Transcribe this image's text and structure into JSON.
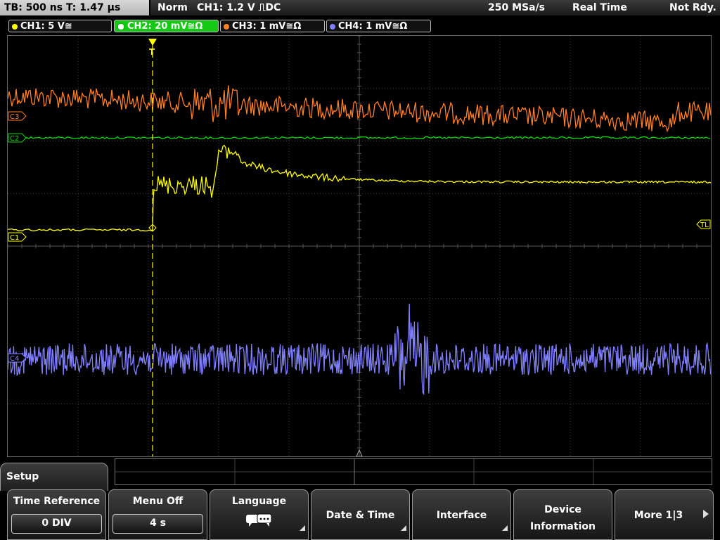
{
  "header": {
    "timebase": "TB: 500 ns   T: 1.47 µs",
    "mode": "Norm",
    "trigger": "CH1: 1.2 V ⎍̸DC",
    "trigger_text": "CH1: 1.2 V",
    "trigger_coupling": "DC",
    "sample_rate": "250 MSa/s",
    "acq_mode": "Real Time",
    "state": "Not Rdy."
  },
  "channels": [
    {
      "label": "CH1: 5 V≅",
      "color": "#ffff00"
    },
    {
      "label": "CH2: 20 mV≅Ω",
      "color": "#00e000"
    },
    {
      "label": "CH3: 1 mV≅Ω",
      "color": "#ff7f27"
    },
    {
      "label": "CH4: 1 mV≅Ω",
      "color": "#8080ff"
    }
  ],
  "markers": {
    "c3": "C3",
    "c2": "C2",
    "c1": "C1",
    "c4": "C4",
    "trigger_level": "TL",
    "trigger_pos": "T"
  },
  "menu": {
    "title": "Setup",
    "softkeys": [
      {
        "title": "Time Reference",
        "value": "0 DIV"
      },
      {
        "title": "Menu Off",
        "value": "4 s"
      },
      {
        "title": "Language",
        "icon": "speech-bubble-icon"
      },
      {
        "title": "Date & Time"
      },
      {
        "title": "Interface"
      },
      {
        "title_line1": "Device",
        "title_line2": "Information"
      },
      {
        "title": "More 1|3"
      }
    ]
  },
  "colors": {
    "ch1": "#ffff00",
    "ch2": "#00e000",
    "ch3": "#ff7f27",
    "ch4": "#8080ff",
    "grid": "#3c3c3c"
  }
}
